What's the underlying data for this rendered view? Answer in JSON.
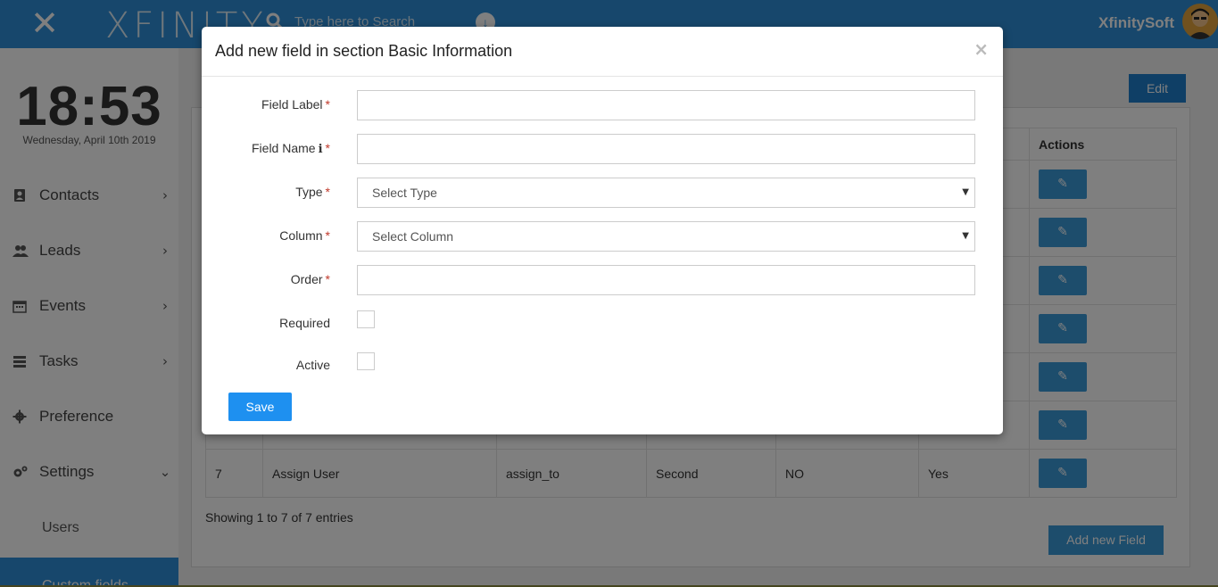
{
  "topbar": {
    "logo": "XFINITY",
    "search_placeholder": "Type here to Search",
    "company": "XfinitySoft"
  },
  "sidebar": {
    "clock": "18:53",
    "date": "Wednesday, April 10th 2019",
    "items": [
      {
        "label": "Contacts",
        "icon": "contacts-icon"
      },
      {
        "label": "Leads",
        "icon": "users-icon"
      },
      {
        "label": "Events",
        "icon": "calendar-icon"
      },
      {
        "label": "Tasks",
        "icon": "tasks-icon"
      },
      {
        "label": "Preference",
        "icon": "gear-icon"
      },
      {
        "label": "Settings",
        "icon": "gears-icon"
      }
    ],
    "sub_items": [
      {
        "label": "Users"
      },
      {
        "label": "Custom fields"
      }
    ]
  },
  "main": {
    "edit_label": "Edit",
    "table": {
      "actions_header": "Actions",
      "last_row": {
        "num": "7",
        "label": "Assign User",
        "name": "assign_to",
        "column": "Second",
        "required": "NO",
        "active": "Yes"
      }
    },
    "showing": "Showing 1 to 7 of 7 entries",
    "add_field_label": "Add new Field"
  },
  "modal": {
    "title": "Add new field in section Basic Information",
    "close": "×",
    "fields": {
      "field_label": "Field Label",
      "field_name": "Field Name",
      "type": "Type",
      "type_placeholder": "Select Type",
      "column": "Column",
      "column_placeholder": "Select Column",
      "order": "Order",
      "required": "Required",
      "active": "Active"
    },
    "required_marker": "*",
    "save_label": "Save"
  },
  "colors": {
    "primary": "#2e8fd8",
    "button": "#1e90f0",
    "required": "#c0392b"
  }
}
